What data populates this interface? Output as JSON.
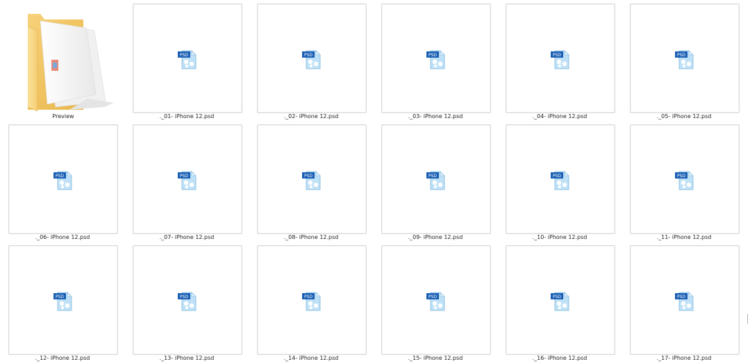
{
  "folder": {
    "name": "Preview",
    "icon": "folder-icon"
  },
  "files": [
    {
      "name": "._01- iPhone 12.psd",
      "icon": "psd-file-icon"
    },
    {
      "name": "._02- iPhone 12.psd",
      "icon": "psd-file-icon"
    },
    {
      "name": "._03- iPhone 12.psd",
      "icon": "psd-file-icon"
    },
    {
      "name": "._04- iPhone 12.psd",
      "icon": "psd-file-icon"
    },
    {
      "name": "._05- iPhone 12.psd",
      "icon": "psd-file-icon"
    },
    {
      "name": "._06- iPhone 12.psd",
      "icon": "psd-file-icon"
    },
    {
      "name": "._07- iPhone 12.psd",
      "icon": "psd-file-icon"
    },
    {
      "name": "._08- iPhone 12.psd",
      "icon": "psd-file-icon"
    },
    {
      "name": "._09- iPhone 12.psd",
      "icon": "psd-file-icon"
    },
    {
      "name": "._10- iPhone 12.psd",
      "icon": "psd-file-icon"
    },
    {
      "name": "._11- iPhone 12.psd",
      "icon": "psd-file-icon"
    },
    {
      "name": "._12- iPhone 12.psd",
      "icon": "psd-file-icon"
    },
    {
      "name": "._13- iPhone 12.psd",
      "icon": "psd-file-icon"
    },
    {
      "name": "._14- iPhone 12.psd",
      "icon": "psd-file-icon"
    },
    {
      "name": "._15- iPhone 12.psd",
      "icon": "psd-file-icon"
    },
    {
      "name": "._16- iPhone 12.psd",
      "icon": "psd-file-icon"
    },
    {
      "name": "._17- iPhone 12.psd",
      "icon": "psd-file-icon"
    }
  ],
  "icon_badge_text": "PSD",
  "colors": {
    "psd_badge": "#1a5fb4",
    "psd_body": "#b9def5",
    "folder_back": "#f3c765",
    "folder_front": "#fbdc8c"
  }
}
